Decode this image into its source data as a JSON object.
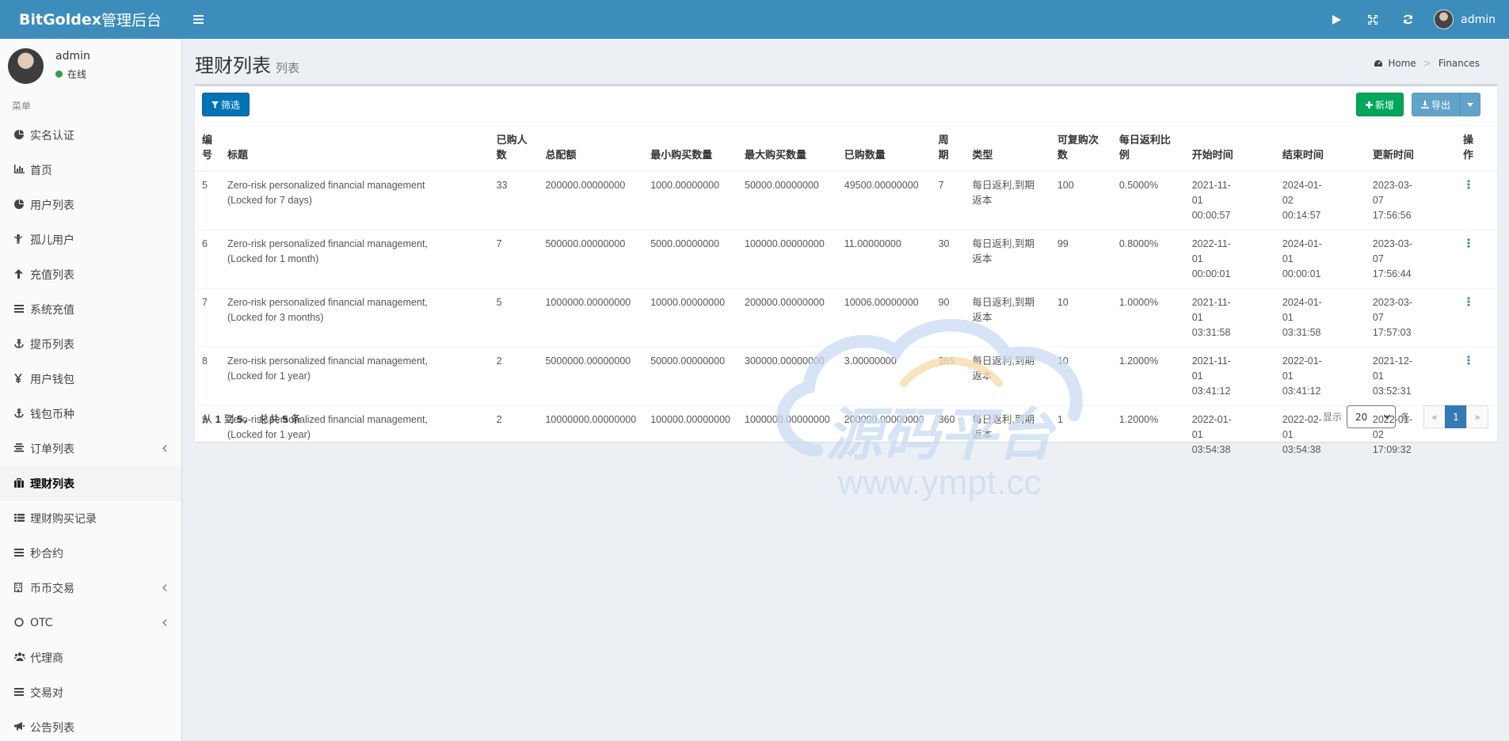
{
  "header": {
    "brand_bold": "BitGoldex",
    "brand_rest": " 管理后台",
    "toggle_icon": "hamburger-icon",
    "user_name": "admin"
  },
  "sidebar": {
    "user_name": "admin",
    "status": "在线",
    "menu_header": "菜单",
    "items": [
      {
        "label": "实名认证",
        "icon": "pie-icon"
      },
      {
        "label": "首页",
        "icon": "bar-chart-icon"
      },
      {
        "label": "用户列表",
        "icon": "pie-icon"
      },
      {
        "label": "孤儿用户",
        "icon": "child-icon"
      },
      {
        "label": "充值列表",
        "icon": "arrow-up-icon"
      },
      {
        "label": "系统充值",
        "icon": "bars-icon"
      },
      {
        "label": "提币列表",
        "icon": "anchor-icon"
      },
      {
        "label": "用户钱包",
        "icon": "yen-icon"
      },
      {
        "label": "钱包币种",
        "icon": "anchor-icon"
      },
      {
        "label": "订单列表",
        "icon": "align-center-icon"
      },
      {
        "label": "理财列表",
        "icon": "suitcase-icon"
      },
      {
        "label": "理财购买记录",
        "icon": "th-list-icon"
      },
      {
        "label": "秒合约",
        "icon": "bars-icon"
      },
      {
        "label": "币币交易",
        "icon": "building-icon"
      },
      {
        "label": "OTC",
        "icon": "circle-icon"
      },
      {
        "label": "代理商",
        "icon": "users-icon"
      },
      {
        "label": "交易对",
        "icon": "bars-icon"
      },
      {
        "label": "公告列表",
        "icon": "bullhorn-icon"
      }
    ]
  },
  "page": {
    "title": "理财列表",
    "subtitle": "列表",
    "breadcrumb_home": "Home",
    "breadcrumb_current": "Finances"
  },
  "toolbar": {
    "filter_label": "筛选",
    "new_label": "新增",
    "export_label": "导出"
  },
  "table": {
    "headers": {
      "id": "编号",
      "title": "标题",
      "buyers": "已购人数",
      "total": "总配额",
      "min": "最小购买数量",
      "max": "最大购买数量",
      "bought": "已购数量",
      "period": "周期",
      "type": "类型",
      "times": "可复购次数",
      "rate": "每日返利比例",
      "start": "开始时间",
      "end": "结束时间",
      "updated": "更新时间",
      "action": "操作"
    },
    "rows": [
      {
        "id": "5",
        "title": "Zero-risk personalized financial management (Locked for 7 days)",
        "buyers": "33",
        "total": "200000.00000000",
        "min": "1000.00000000",
        "max": "50000.00000000",
        "bought": "49500.00000000",
        "period": "7",
        "type": "每日返利,到期返本",
        "times": "100",
        "rate": "0.5000%",
        "start": "2021-11-01 00:00:57",
        "end": "2024-01-02 00:14:57",
        "updated": "2023-03-07 17:56:56"
      },
      {
        "id": "6",
        "title": "Zero-risk personalized financial management, (Locked for 1 month)",
        "buyers": "7",
        "total": "500000.00000000",
        "min": "5000.00000000",
        "max": "100000.00000000",
        "bought": "11.00000000",
        "period": "30",
        "type": "每日返利,到期返本",
        "times": "99",
        "rate": "0.8000%",
        "start": "2022-11-01 00:00:01",
        "end": "2024-01-01 00:00:01",
        "updated": "2023-03-07 17:56:44"
      },
      {
        "id": "7",
        "title": "Zero-risk personalized financial management, (Locked for 3 months)",
        "buyers": "5",
        "total": "1000000.00000000",
        "min": "10000.00000000",
        "max": "200000.00000000",
        "bought": "10006.00000000",
        "period": "90",
        "type": "每日返利,到期返本",
        "times": "10",
        "rate": "1.0000%",
        "start": "2021-11-01 03:31:58",
        "end": "2024-01-01 03:31:58",
        "updated": "2023-03-07 17:57:03"
      },
      {
        "id": "8",
        "title": "Zero-risk personalized financial management, (Locked for 1 year)",
        "buyers": "2",
        "total": "5000000.00000000",
        "min": "50000.00000000",
        "max": "300000.00000000",
        "bought": "3.00000000",
        "period": "365",
        "type": "每日返利,到期返本",
        "times": "10",
        "rate": "1.2000%",
        "start": "2021-11-01 03:41:12",
        "end": "2022-01-01 03:41:12",
        "updated": "2021-12-01 03:52:31"
      },
      {
        "id": "9",
        "title": "Zero-risk personalized financial management, (Locked for 1 year)",
        "buyers": "2",
        "total": "10000000.00000000",
        "min": "100000.00000000",
        "max": "1000000.00000000",
        "bought": "200000.00000000",
        "period": "360",
        "type": "每日返利,到期返本",
        "times": "1",
        "rate": "1.2000%",
        "start": "2022-01-01 03:54:38",
        "end": "2022-02-01 03:54:38",
        "updated": "2022-01-02 17:09:32"
      }
    ]
  },
  "pagination": {
    "info_from": "从",
    "start": "1",
    "info_to": "到",
    "end": "5",
    "info_total": "，  总共",
    "total": "5",
    "info_unit": "条",
    "show_label": "显示",
    "page_size": "20",
    "unit": "条",
    "prev": "«",
    "current": "1",
    "next": "»"
  },
  "watermark": {
    "text_cn": "源码平台",
    "text_url": "www.ympt.cc"
  }
}
